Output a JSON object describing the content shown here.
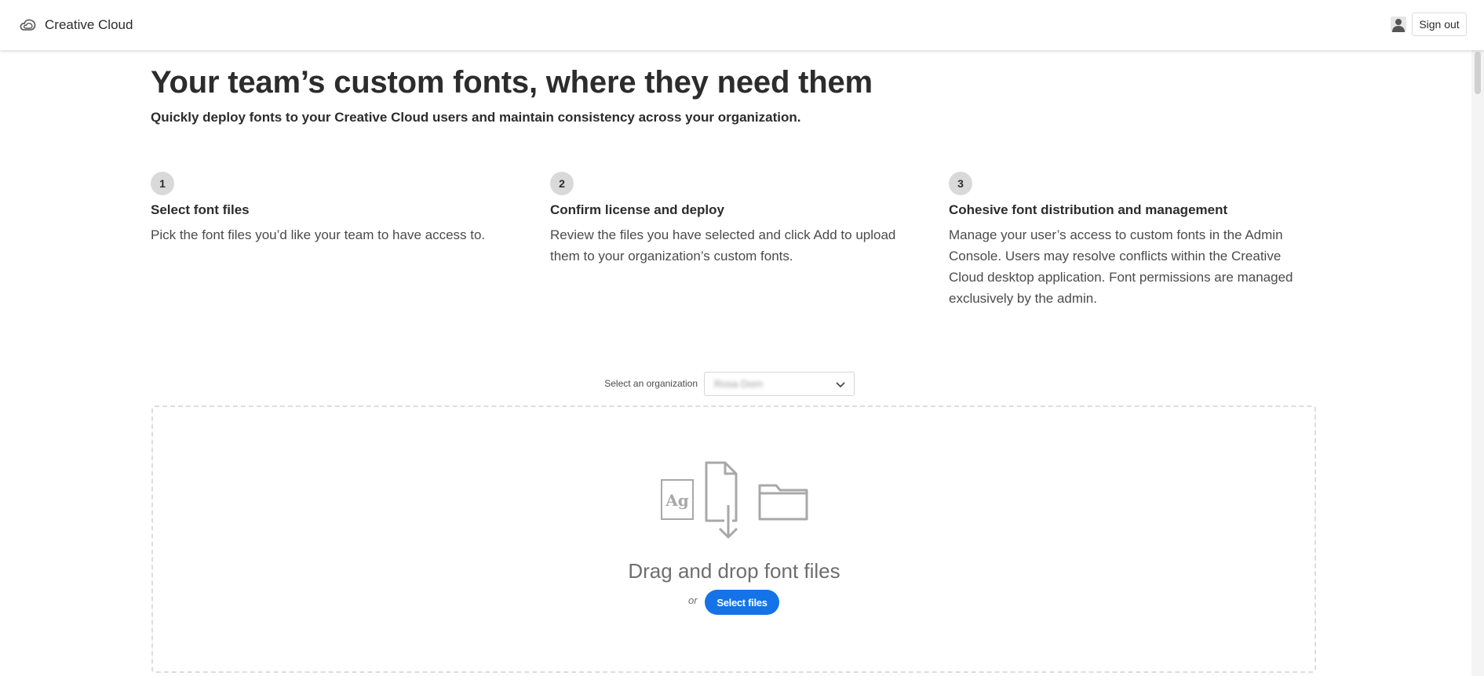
{
  "header": {
    "app_name": "Creative Cloud",
    "logo_icon": "creative-cloud-logo-icon",
    "avatar_icon": "user-avatar-icon",
    "sign_out_label": "Sign out"
  },
  "hero": {
    "title": "Your team’s custom fonts, where they need them",
    "subtitle": "Quickly deploy fonts to your Creative Cloud users and maintain consistency across your organization."
  },
  "steps": [
    {
      "number": "1",
      "title": "Select font files",
      "description": "Pick the font files you’d like your team to have access to."
    },
    {
      "number": "2",
      "title": "Confirm license and deploy",
      "description": "Review the files you have selected and click Add to upload them to your organization’s custom fonts."
    },
    {
      "number": "3",
      "title": "Cohesive font distribution and management",
      "description": "Manage your user’s access to custom fonts in the Admin Console. Users may resolve conflicts within the Creative Cloud desktop application. Font permissions are managed exclusively by the admin."
    }
  ],
  "organization": {
    "label": "Select an organization",
    "selected_value": "Rosa Dorn",
    "chevron_icon": "chevron-down-icon"
  },
  "dropzone": {
    "icons": [
      "font-file-icon",
      "file-download-icon",
      "folder-icon"
    ],
    "font_sample_glyph": "Ag",
    "title": "Drag and drop font files",
    "or_text": "or",
    "select_files_label": "Select files"
  },
  "colors": {
    "accent": "#1473e6",
    "text": "#2c2c2c",
    "muted_text": "#4b4b4b",
    "icon_gray": "#a8a8a8",
    "step_badge": "#d9d9d9"
  }
}
